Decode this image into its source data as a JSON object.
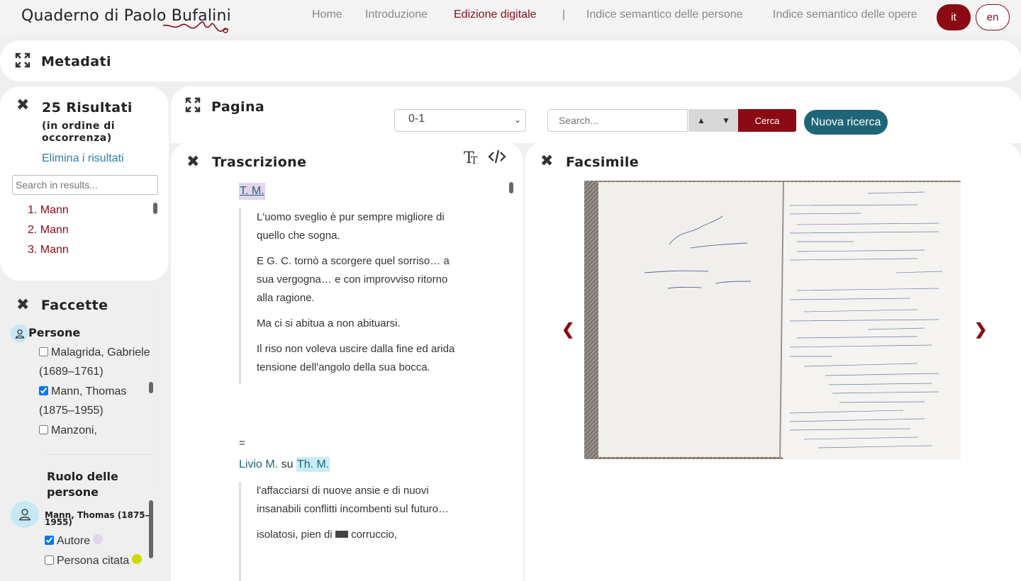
{
  "header": {
    "brand": "Quaderno di Paolo Bufalini",
    "nav": [
      {
        "label": "Home",
        "active": false
      },
      {
        "label": "Introduzione",
        "active": false
      },
      {
        "label": "Edizione digitale",
        "active": true
      },
      {
        "label": "|",
        "active": false
      },
      {
        "label": "Indice semantico delle persone",
        "active": false
      },
      {
        "label": "Indice semantico delle opere",
        "active": false
      }
    ],
    "lang_it": "it",
    "lang_en": "en"
  },
  "metadata": {
    "title": "Metadati"
  },
  "results": {
    "title": "25 Risultati",
    "subtitle": "(in ordine di occorrenza)",
    "clear_label": "Elimina i risultati",
    "search_placeholder": "Search in results...",
    "items": [
      "1. Mann",
      "2. Mann",
      "3. Mann"
    ]
  },
  "facets": {
    "title": "Faccette",
    "persons_label": "Persone",
    "persons": [
      {
        "label": "Malagrida, Gabriele (1689–1761)",
        "checked": false
      },
      {
        "label": "Mann, Thomas (1875–1955)",
        "checked": true
      },
      {
        "label": "Manzoni,",
        "checked": false
      }
    ],
    "role_title": "Ruolo delle persone",
    "role_person": "Mann, Thomas (1875–1955)",
    "roles": [
      {
        "label": "Autore",
        "checked": true,
        "color": "#e4d3ec"
      },
      {
        "label": "Persona citata",
        "checked": false,
        "color": "#c8dc00"
      }
    ]
  },
  "page": {
    "title": "Pagina",
    "selected_page": "0-1",
    "search_placeholder": "Search...",
    "search_button": "Cerca",
    "new_search_button": "Nuova ricerca"
  },
  "transcription": {
    "title": "Trascrizione",
    "author_tag": "T. M.",
    "quote1": [
      "L'uomo sveglio è pur sempre migliore di quello che sogna.",
      "E G. C. tornò a scorgere quel sorriso… a sua vergogna… e con improvviso ritorno alla ragione.",
      "Ma ci si abitua a non abituarsi.",
      "Il riso non voleva uscire dalla fine ed arida tensione dell'angolo della sua bocca."
    ],
    "equals": "=",
    "livio": "Livio M.",
    "su": "su",
    "thm": "Th. M.",
    "quote2": [
      "l'affacciarsi di nuove ansie e di nuovi insanabili conflitti incombenti sul futuro…"
    ],
    "quote2_last_before": "isolatosi, pien di",
    "quote2_last_after": "corruccio,"
  },
  "facsimile": {
    "title": "Facsimile",
    "prev_icon": "chevron-left-icon",
    "next_icon": "chevron-right-icon"
  },
  "colors": {
    "accent": "#8b0a14",
    "teal": "#1e6577"
  }
}
